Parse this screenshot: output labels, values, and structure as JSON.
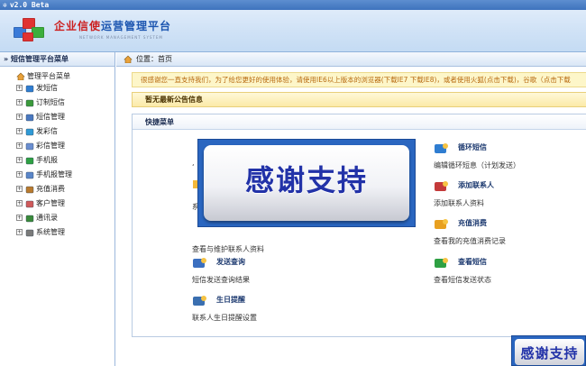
{
  "app": {
    "version": "v2.0 Beta",
    "title_red": "企业信使",
    "title_blue": "运营管理平台",
    "subtitle": "NETWORK MANAGEMENT SYSTEM"
  },
  "sidebar": {
    "header": "» 短信管理平台菜单",
    "root": "管理平台菜单",
    "items": [
      {
        "label": "发短信",
        "icon": "send-sms-icon"
      },
      {
        "label": "订制短信",
        "icon": "subscribe-sms-icon"
      },
      {
        "label": "短信管理",
        "icon": "sms-manage-icon"
      },
      {
        "label": "发彩信",
        "icon": "send-mms-icon"
      },
      {
        "label": "彩信管理",
        "icon": "mms-manage-icon"
      },
      {
        "label": "手机报",
        "icon": "mobile-news-icon"
      },
      {
        "label": "手机报管理",
        "icon": "mobile-news-manage-icon"
      },
      {
        "label": "充值消费",
        "icon": "recharge-icon"
      },
      {
        "label": "客户管理",
        "icon": "customer-icon"
      },
      {
        "label": "通讯录",
        "icon": "contacts-icon"
      },
      {
        "label": "系统管理",
        "icon": "system-gear-icon"
      }
    ]
  },
  "breadcrumb": {
    "prefix": "位置：",
    "current": "首页"
  },
  "notice": "很感谢您一直支持我们，为了给您更好的使用体验，请使用IE6以上版本的浏览器(下载IE7 下载IE8)，或者使用火狐(点击下载)，谷歌（点击下载",
  "latest_panel": {
    "title": "暂无最新公告信息"
  },
  "quick_panel": {
    "title": "快捷菜单",
    "items": [
      {
        "title": "循环短信",
        "desc": "编辑循环短息（计划发送）",
        "icon": "cycle-sms-icon"
      },
      {
        "title": "添加联系人",
        "desc": "添加联系人资料",
        "icon": "add-contact-icon"
      },
      {
        "title": "",
        "desc": "查看与维护联系人资料",
        "icon": "contacts-book-icon"
      },
      {
        "title": "充值消费",
        "desc": "查看我的充值消费记录",
        "icon": "recharge-record-icon"
      },
      {
        "title": "发送查询",
        "desc": "短信发送查询结果",
        "icon": "send-query-icon"
      },
      {
        "title": "查看短信",
        "desc": "查看短信发送状态",
        "icon": "view-sms-icon"
      },
      {
        "title": "生日提醒",
        "desc": "联系人生日提醒设置",
        "icon": "birthday-icon"
      }
    ],
    "partial_left": [
      "‘",
      "系"
    ]
  },
  "ad": {
    "text": "感谢支持"
  },
  "ad_small": {
    "text": "感谢支持"
  }
}
